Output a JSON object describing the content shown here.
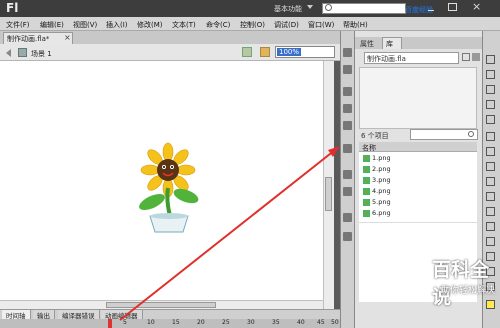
{
  "app": {
    "logo": "Fl",
    "workspace": "基本功能",
    "watermark_top": "百度经验"
  },
  "menu": [
    "文件(F)",
    "编辑(E)",
    "视图(V)",
    "插入(I)",
    "修改(M)",
    "文本(T)",
    "命令(C)",
    "控制(O)",
    "调试(D)",
    "窗口(W)",
    "帮助(H)"
  ],
  "document": {
    "tab_label": "制作动画.fla*",
    "close_symbol": "×",
    "scene_label": "场景 1",
    "zoom": "100%"
  },
  "timeline": {
    "tabs": [
      "时间轴",
      "输出",
      "编译器错误",
      "动画编辑器"
    ],
    "frame_numbers": [
      "5",
      "10",
      "15",
      "20",
      "25",
      "30",
      "35",
      "40",
      "45",
      "50"
    ]
  },
  "library": {
    "tab_properties": "属性",
    "tab_library": "库",
    "document_name": "制作动画.fla",
    "item_count": "6 个项目",
    "column_name": "名称",
    "items": [
      "1.png",
      "2.png",
      "3.png",
      "4.png",
      "5.png",
      "6.png"
    ]
  },
  "watermark": {
    "main": "百科全说",
    "sub": "助你轻松解决"
  },
  "colors": {
    "title_bar": "#3d3d3d",
    "accent_blue": "#3a6fc9",
    "arrow_red": "#e0302b",
    "library_icon": "#6aa84f"
  }
}
